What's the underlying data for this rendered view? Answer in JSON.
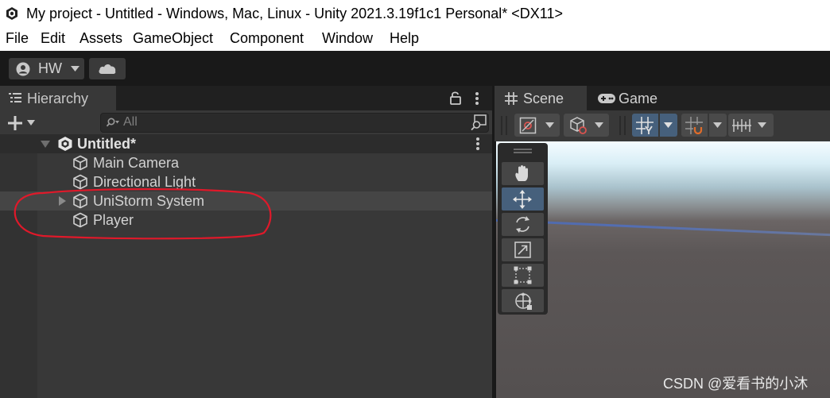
{
  "window": {
    "title": "My project - Untitled - Windows, Mac, Linux - Unity 2021.3.19f1c1 Personal* <DX11>"
  },
  "menu": [
    {
      "label": "File"
    },
    {
      "label": "Edit"
    },
    {
      "label": "Assets"
    },
    {
      "label": "GameObject"
    },
    {
      "label": "Component"
    },
    {
      "label": "Window"
    },
    {
      "label": "Help"
    }
  ],
  "toolbar": {
    "account_label": "HW",
    "account_icon": "user-icon",
    "cloud_icon": "cloud-icon"
  },
  "hierarchy": {
    "tab_label": "Hierarchy",
    "search_placeholder": "All",
    "scene_name": "Untitled*",
    "items": [
      {
        "label": "Main Camera",
        "expandable": false
      },
      {
        "label": "Directional Light",
        "expandable": false
      },
      {
        "label": "UniStorm System",
        "expandable": true
      },
      {
        "label": "Player",
        "expandable": false
      }
    ]
  },
  "scene": {
    "tabs": [
      {
        "label": "Scene",
        "icon": "hash-icon"
      },
      {
        "label": "Game",
        "icon": "gamepad-icon"
      }
    ],
    "tools": [
      "hand-icon",
      "move-icon",
      "rotate-icon",
      "scale-icon",
      "rect-icon",
      "transform-icon"
    ],
    "active_tool": "move-icon"
  },
  "watermark": "CSDN @爱看书的小沐",
  "colors": {
    "accent": "#46607c",
    "annotation": "#e0192a",
    "panel": "#383838"
  }
}
